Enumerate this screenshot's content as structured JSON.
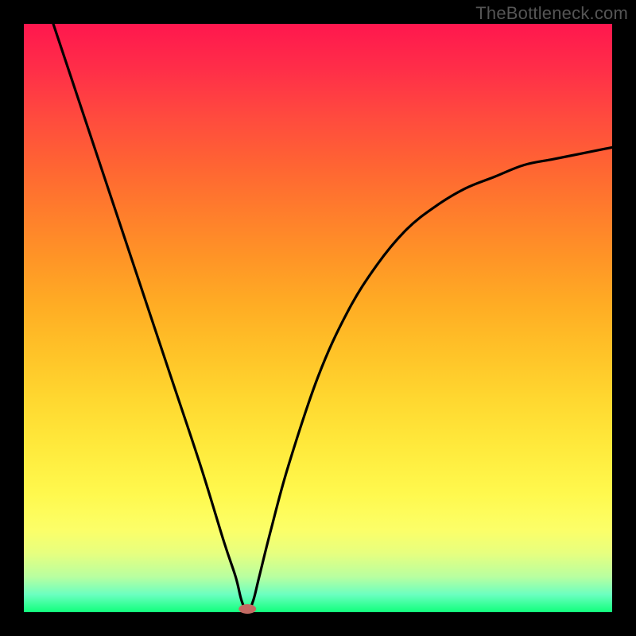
{
  "attribution": "TheBottleneck.com",
  "chart_data": {
    "type": "line",
    "title": "",
    "xlabel": "",
    "ylabel": "",
    "xlim": [
      0,
      100
    ],
    "ylim": [
      0,
      100
    ],
    "legend": false,
    "grid": false,
    "background_gradient": {
      "direction": "vertical",
      "stops": [
        {
          "pos": 0,
          "color": "#ff174e"
        },
        {
          "pos": 50,
          "color": "#ffad24"
        },
        {
          "pos": 80,
          "color": "#fff94e"
        },
        {
          "pos": 100,
          "color": "#12ff7c"
        }
      ]
    },
    "notch_x": 38,
    "series": [
      {
        "name": "bottleneck-curve",
        "color": "#000000",
        "x": [
          5,
          10,
          15,
          20,
          25,
          30,
          34,
          36,
          37,
          38,
          39,
          40,
          42,
          45,
          50,
          55,
          60,
          65,
          70,
          75,
          80,
          85,
          90,
          95,
          100
        ],
        "y": [
          100,
          85,
          70,
          55,
          40,
          25,
          12,
          6,
          2,
          0,
          2,
          6,
          14,
          25,
          40,
          51,
          59,
          65,
          69,
          72,
          74,
          76,
          77,
          78,
          79
        ]
      }
    ],
    "marker": {
      "x": 38,
      "y": 0,
      "color": "#c46a63",
      "shape": "pill"
    }
  }
}
